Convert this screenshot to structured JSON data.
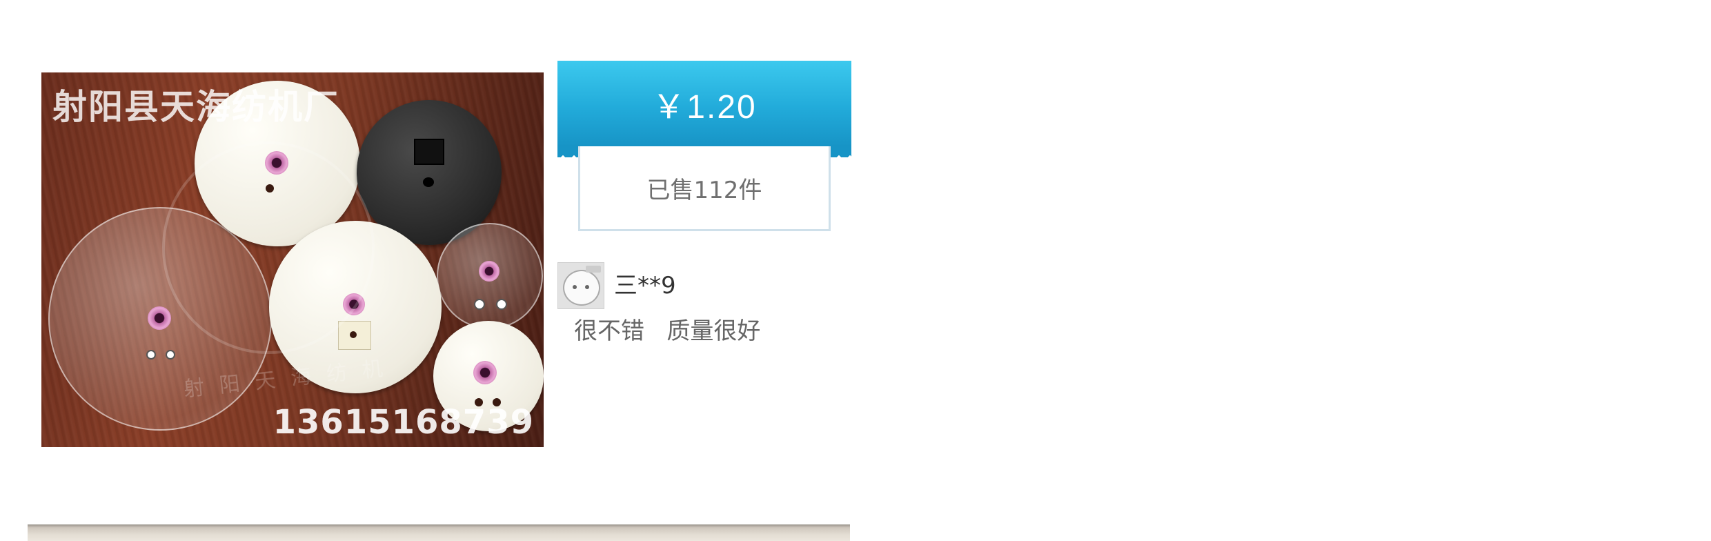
{
  "product": {
    "image_watermark_top": "射阳县天海纺机厂",
    "image_watermark_mid": "射阳天海纺机",
    "image_phone": "13615168739",
    "image_icon": "textile-disc-photo"
  },
  "price": {
    "label": "￥1.20",
    "accent_color": "#22abda"
  },
  "sales": {
    "sold_label": "已售112件"
  },
  "review": {
    "reviewer_name": "三**9",
    "avatar_icon": "avatar-icon",
    "text": "很不错   质量很好"
  }
}
